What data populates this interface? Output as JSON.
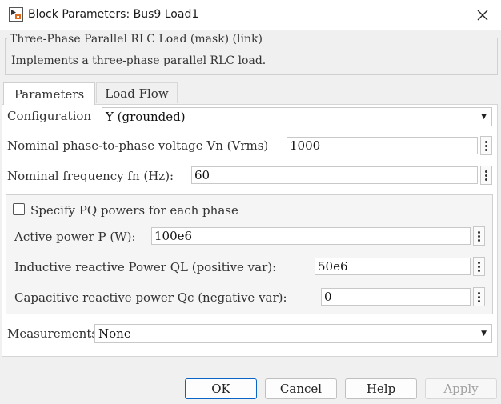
{
  "window": {
    "title": "Block Parameters: Bus9 Load1",
    "app_icon": "simulink-block-icon",
    "close_icon": "close-icon"
  },
  "mask": {
    "legend": "Three-Phase Parallel RLC Load (mask) (link)",
    "description": "Implements a three-phase parallel RLC load."
  },
  "tabs": [
    {
      "label": "Parameters",
      "active": true
    },
    {
      "label": "Load Flow",
      "active": false
    }
  ],
  "params": {
    "configuration": {
      "label": "Configuration",
      "value": "Y (grounded)"
    },
    "nominal_voltage": {
      "label": "Nominal phase-to-phase voltage Vn (Vrms)",
      "value": "1000"
    },
    "nominal_frequency": {
      "label": "Nominal frequency fn (Hz):",
      "value": "60"
    },
    "specify_pq": {
      "label": "Specify PQ powers for each phase",
      "checked": false
    },
    "active_power": {
      "label": "Active power P (W):",
      "value": "100e6"
    },
    "inductive_power": {
      "label": "Inductive reactive Power QL (positive var):",
      "value": "50e6"
    },
    "capacitive_power": {
      "label": "Capacitive reactive power Qc (negative var):",
      "value": "0"
    },
    "measurements": {
      "label": "Measurements",
      "value": "None"
    }
  },
  "buttons": {
    "ok": "OK",
    "cancel": "Cancel",
    "help": "Help",
    "apply": "Apply"
  },
  "colors": {
    "accent": "#0a64c8",
    "disabled_text": "#a0a0a0"
  }
}
